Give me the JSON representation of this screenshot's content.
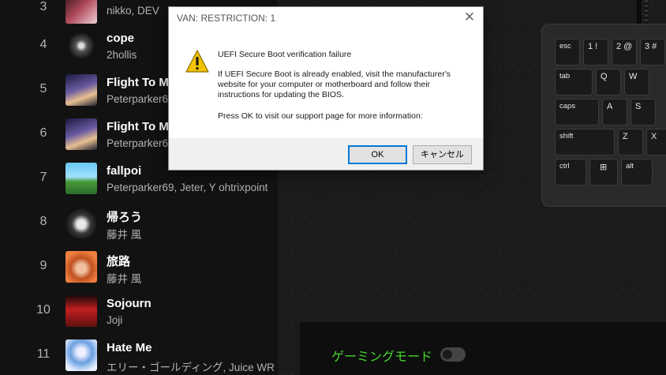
{
  "colors": {
    "accent_green": "#44d62c",
    "bg": "#121212"
  },
  "tracks": [
    {
      "num": "3",
      "title": "",
      "artist": "nikko, DEV"
    },
    {
      "num": "4",
      "title": "cope",
      "artist": "2hollis"
    },
    {
      "num": "5",
      "title": "Flight To M",
      "artist": "Peterparker6"
    },
    {
      "num": "6",
      "title": "Flight To M",
      "artist": "Peterparker6"
    },
    {
      "num": "7",
      "title": "fallpoi",
      "artist": "Peterparker69, Jeter, Y ohtrixpoint"
    },
    {
      "num": "8",
      "title": "帰ろう",
      "artist": "藤井 風"
    },
    {
      "num": "9",
      "title": "旅路",
      "artist": "藤井 風"
    },
    {
      "num": "10",
      "title": "Sojourn",
      "artist": "Joji"
    },
    {
      "num": "11",
      "title": "Hate Me",
      "artist": "エリー・ゴールディング, Juice WR"
    }
  ],
  "dialog": {
    "title": "VAN: RESTRICTION: 1",
    "close": "✕",
    "heading": "UEFI Secure Boot verification failure",
    "body": "If UEFI Secure Boot is already enabled, visit the manufacturer's website for your computer or motherboard and follow their instructions for updating the BIOS.",
    "prompt": "Press OK to visit our support page for more information:",
    "ok_label": "OK",
    "cancel_label": "キャンセル"
  },
  "gaming": {
    "mode_label": "ゲーミングモード",
    "toggle_state": "off",
    "keys": {
      "esc": "esc",
      "one": "1  !",
      "two": "2  @",
      "three": "3  #",
      "tab": "tab",
      "q": "Q",
      "w": "W",
      "caps": "caps",
      "a": "A",
      "s": "S",
      "shift": "shift",
      "z": "Z",
      "x": "X",
      "ctrl": "ctrl",
      "win": "⊞",
      "alt": "alt"
    }
  }
}
